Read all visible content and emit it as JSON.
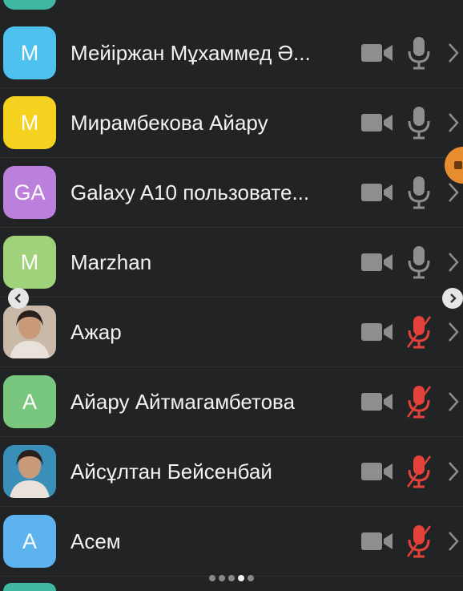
{
  "participants": [
    {
      "name": "Мейіржан Мұхаммед Ә...",
      "initials": "М",
      "avatar_color": "#4fc1ee",
      "avatar_type": "initials",
      "muted": false
    },
    {
      "name": "Мирамбекова Айару",
      "initials": "М",
      "avatar_color": "#f5d21f",
      "avatar_type": "initials",
      "muted": false
    },
    {
      "name": "Galaxy A10 пользовате...",
      "initials": "GA",
      "avatar_color": "#bb7fdc",
      "avatar_type": "initials",
      "muted": false
    },
    {
      "name": "Marzhan",
      "initials": "M",
      "avatar_color": "#9fd27a",
      "avatar_type": "initials",
      "muted": false
    },
    {
      "name": "Ажар",
      "initials": "",
      "avatar_color": "#c9b9a8",
      "avatar_type": "photo",
      "muted": true
    },
    {
      "name": "Айару Айтмагамбетова",
      "initials": "A",
      "avatar_color": "#79c77e",
      "avatar_type": "initials",
      "muted": true
    },
    {
      "name": "Айсұлтан Бейсенбай",
      "initials": "",
      "avatar_color": "#3a8fb8",
      "avatar_type": "photo",
      "muted": true
    },
    {
      "name": "Асем",
      "initials": "А",
      "avatar_color": "#5cb3ee",
      "avatar_type": "initials",
      "muted": true
    }
  ],
  "colors": {
    "icon_gray": "#8d8e90",
    "muted_red": "#e3423b",
    "background": "#222324"
  },
  "page_indicator": {
    "total": 5,
    "current": 4
  }
}
